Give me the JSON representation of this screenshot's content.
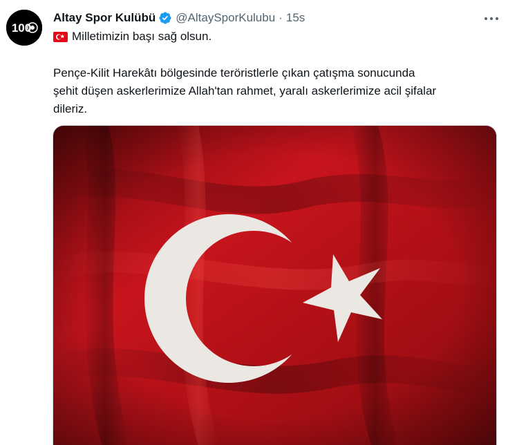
{
  "tweet": {
    "display_name": "Altay Spor Kulübü",
    "handle": "@AltaySporKulubu",
    "separator": "·",
    "time": "15s",
    "line1": "Milletimizin başı sağ olsun.",
    "body_lines": [
      "Pençe-Kilit Harekâtı bölgesinde teröristlerle çıkan çatışma sonucunda",
      "şehit düşen askerlerimize Allah'tan rahmet, yaralı askerlerimize acil şifalar",
      "dileriz."
    ]
  },
  "avatar": {
    "text": "100",
    "colors": {
      "background": "#000000",
      "mark": "#ffffff"
    }
  },
  "icons": {
    "verified": "verified-badge-icon",
    "more": "more-dots-icon",
    "flag_emoji": "turkey-flag-emoji-icon"
  },
  "colors": {
    "text_primary": "#0f1419",
    "text_secondary": "#536471",
    "verified_blue": "#1d9bf0",
    "flag_red": "#c8141c",
    "flag_white": "#f1efec",
    "border": "#cfd9de"
  }
}
